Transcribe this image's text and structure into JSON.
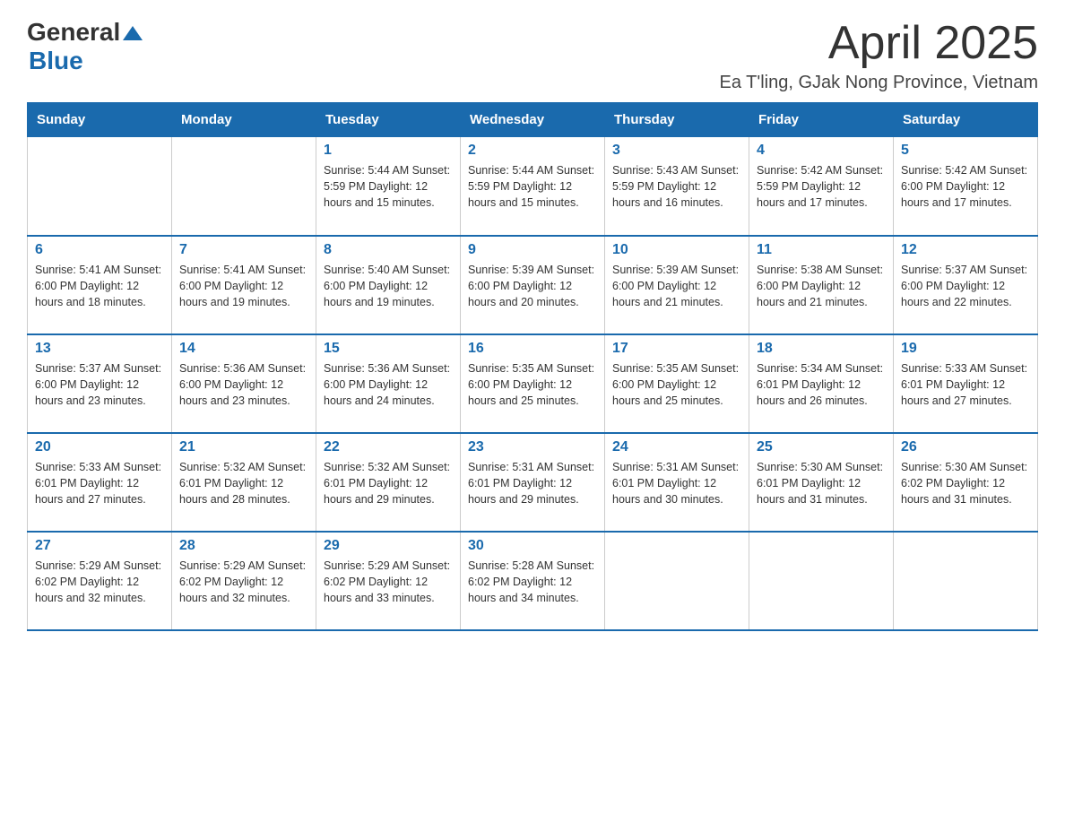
{
  "header": {
    "logo_general": "General",
    "logo_blue": "Blue",
    "month_title": "April 2025",
    "location": "Ea T'ling, GJak Nong Province, Vietnam"
  },
  "weekdays": [
    "Sunday",
    "Monday",
    "Tuesday",
    "Wednesday",
    "Thursday",
    "Friday",
    "Saturday"
  ],
  "weeks": [
    [
      {
        "day": "",
        "info": ""
      },
      {
        "day": "",
        "info": ""
      },
      {
        "day": "1",
        "info": "Sunrise: 5:44 AM\nSunset: 5:59 PM\nDaylight: 12 hours\nand 15 minutes."
      },
      {
        "day": "2",
        "info": "Sunrise: 5:44 AM\nSunset: 5:59 PM\nDaylight: 12 hours\nand 15 minutes."
      },
      {
        "day": "3",
        "info": "Sunrise: 5:43 AM\nSunset: 5:59 PM\nDaylight: 12 hours\nand 16 minutes."
      },
      {
        "day": "4",
        "info": "Sunrise: 5:42 AM\nSunset: 5:59 PM\nDaylight: 12 hours\nand 17 minutes."
      },
      {
        "day": "5",
        "info": "Sunrise: 5:42 AM\nSunset: 6:00 PM\nDaylight: 12 hours\nand 17 minutes."
      }
    ],
    [
      {
        "day": "6",
        "info": "Sunrise: 5:41 AM\nSunset: 6:00 PM\nDaylight: 12 hours\nand 18 minutes."
      },
      {
        "day": "7",
        "info": "Sunrise: 5:41 AM\nSunset: 6:00 PM\nDaylight: 12 hours\nand 19 minutes."
      },
      {
        "day": "8",
        "info": "Sunrise: 5:40 AM\nSunset: 6:00 PM\nDaylight: 12 hours\nand 19 minutes."
      },
      {
        "day": "9",
        "info": "Sunrise: 5:39 AM\nSunset: 6:00 PM\nDaylight: 12 hours\nand 20 minutes."
      },
      {
        "day": "10",
        "info": "Sunrise: 5:39 AM\nSunset: 6:00 PM\nDaylight: 12 hours\nand 21 minutes."
      },
      {
        "day": "11",
        "info": "Sunrise: 5:38 AM\nSunset: 6:00 PM\nDaylight: 12 hours\nand 21 minutes."
      },
      {
        "day": "12",
        "info": "Sunrise: 5:37 AM\nSunset: 6:00 PM\nDaylight: 12 hours\nand 22 minutes."
      }
    ],
    [
      {
        "day": "13",
        "info": "Sunrise: 5:37 AM\nSunset: 6:00 PM\nDaylight: 12 hours\nand 23 minutes."
      },
      {
        "day": "14",
        "info": "Sunrise: 5:36 AM\nSunset: 6:00 PM\nDaylight: 12 hours\nand 23 minutes."
      },
      {
        "day": "15",
        "info": "Sunrise: 5:36 AM\nSunset: 6:00 PM\nDaylight: 12 hours\nand 24 minutes."
      },
      {
        "day": "16",
        "info": "Sunrise: 5:35 AM\nSunset: 6:00 PM\nDaylight: 12 hours\nand 25 minutes."
      },
      {
        "day": "17",
        "info": "Sunrise: 5:35 AM\nSunset: 6:00 PM\nDaylight: 12 hours\nand 25 minutes."
      },
      {
        "day": "18",
        "info": "Sunrise: 5:34 AM\nSunset: 6:01 PM\nDaylight: 12 hours\nand 26 minutes."
      },
      {
        "day": "19",
        "info": "Sunrise: 5:33 AM\nSunset: 6:01 PM\nDaylight: 12 hours\nand 27 minutes."
      }
    ],
    [
      {
        "day": "20",
        "info": "Sunrise: 5:33 AM\nSunset: 6:01 PM\nDaylight: 12 hours\nand 27 minutes."
      },
      {
        "day": "21",
        "info": "Sunrise: 5:32 AM\nSunset: 6:01 PM\nDaylight: 12 hours\nand 28 minutes."
      },
      {
        "day": "22",
        "info": "Sunrise: 5:32 AM\nSunset: 6:01 PM\nDaylight: 12 hours\nand 29 minutes."
      },
      {
        "day": "23",
        "info": "Sunrise: 5:31 AM\nSunset: 6:01 PM\nDaylight: 12 hours\nand 29 minutes."
      },
      {
        "day": "24",
        "info": "Sunrise: 5:31 AM\nSunset: 6:01 PM\nDaylight: 12 hours\nand 30 minutes."
      },
      {
        "day": "25",
        "info": "Sunrise: 5:30 AM\nSunset: 6:01 PM\nDaylight: 12 hours\nand 31 minutes."
      },
      {
        "day": "26",
        "info": "Sunrise: 5:30 AM\nSunset: 6:02 PM\nDaylight: 12 hours\nand 31 minutes."
      }
    ],
    [
      {
        "day": "27",
        "info": "Sunrise: 5:29 AM\nSunset: 6:02 PM\nDaylight: 12 hours\nand 32 minutes."
      },
      {
        "day": "28",
        "info": "Sunrise: 5:29 AM\nSunset: 6:02 PM\nDaylight: 12 hours\nand 32 minutes."
      },
      {
        "day": "29",
        "info": "Sunrise: 5:29 AM\nSunset: 6:02 PM\nDaylight: 12 hours\nand 33 minutes."
      },
      {
        "day": "30",
        "info": "Sunrise: 5:28 AM\nSunset: 6:02 PM\nDaylight: 12 hours\nand 34 minutes."
      },
      {
        "day": "",
        "info": ""
      },
      {
        "day": "",
        "info": ""
      },
      {
        "day": "",
        "info": ""
      }
    ]
  ]
}
